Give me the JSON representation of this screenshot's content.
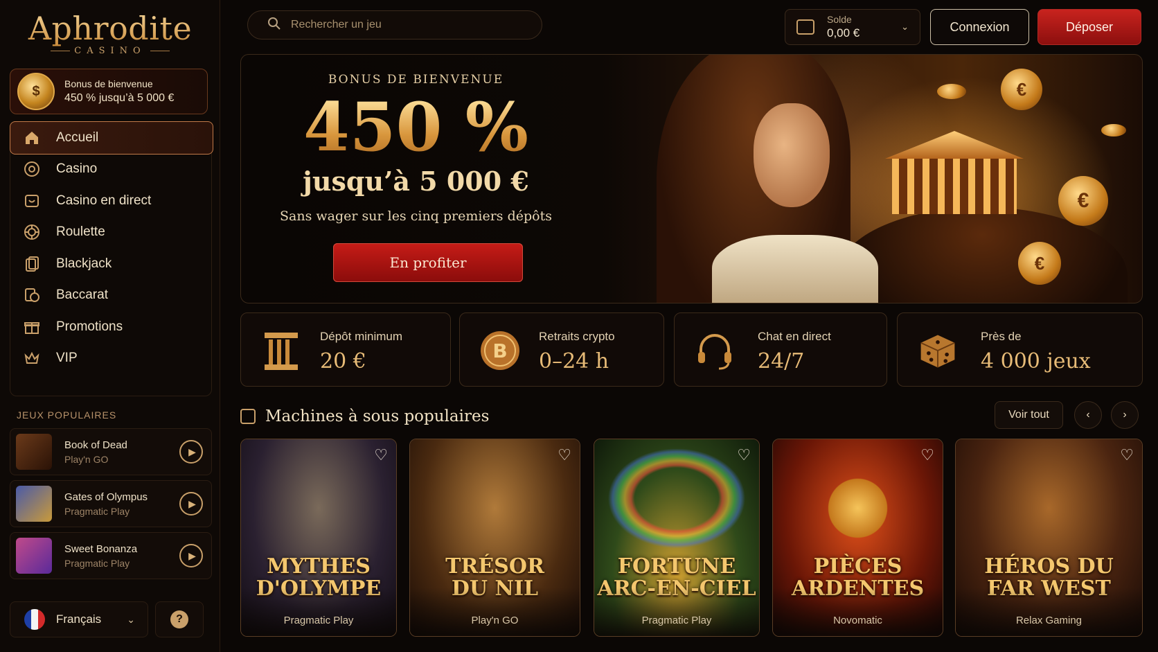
{
  "brand": {
    "name": "Aphrodite",
    "sub": "CASINO"
  },
  "sidebar": {
    "bonus": {
      "line1": "Bonus de bienvenue",
      "line2": "450 % jusqu’à 5 000 €"
    },
    "nav": [
      {
        "label": "Accueil",
        "icon": "home-icon",
        "active": true
      },
      {
        "label": "Casino",
        "icon": "chip-icon"
      },
      {
        "label": "Casino en direct",
        "icon": "live-casino-icon"
      },
      {
        "label": "Roulette",
        "icon": "roulette-icon"
      },
      {
        "label": "Blackjack",
        "icon": "cards-icon"
      },
      {
        "label": "Baccarat",
        "icon": "baccarat-icon"
      },
      {
        "label": "Promotions",
        "icon": "gift-icon"
      },
      {
        "label": "VIP",
        "icon": "crown-icon"
      }
    ],
    "popular_title": "JEUX POPULAIRES",
    "popular": [
      {
        "name": "Book of Dead",
        "provider": "Play'n GO"
      },
      {
        "name": "Gates of Olympus",
        "provider": "Pragmatic Play"
      },
      {
        "name": "Sweet Bonanza",
        "provider": "Pragmatic Play"
      }
    ],
    "language": "Français",
    "help": "?"
  },
  "header": {
    "search_placeholder": "Rechercher un jeu",
    "balance_label": "Solde",
    "balance_value": "0,00 €",
    "login": "Connexion",
    "deposit": "Déposer"
  },
  "hero": {
    "kicker": "BONUS DE BIENVENUE",
    "big": "450 %",
    "mid": "jusqu’à 5 000 €",
    "small": "Sans wager sur les cinq premiers dépôts",
    "cta": "En profiter"
  },
  "stats": [
    {
      "label": "Dépôt minimum",
      "value": "20 €",
      "icon": "column-icon"
    },
    {
      "label": "Retraits crypto",
      "value": "0–24 h",
      "icon": "bitcoin-icon"
    },
    {
      "label": "Chat en direct",
      "value": "24/7",
      "icon": "headset-icon"
    },
    {
      "label": "Près de",
      "value": "4 000 jeux",
      "icon": "dice-icon"
    }
  ],
  "slots": {
    "title": "Machines à sous populaires",
    "see_all": "Voir tout",
    "prev": "‹",
    "next": "›",
    "games": [
      {
        "title": "MYTHES\nD'OLYMPE",
        "provider": "Pragmatic Play"
      },
      {
        "title": "TRÉSOR\nDU NIL",
        "provider": "Play'n GO"
      },
      {
        "title": "FORTUNE\nARC-EN-CIEL",
        "provider": "Pragmatic Play"
      },
      {
        "title": "PIÈCES\nARDENTES",
        "provider": "Novomatic"
      },
      {
        "title": "HÉROS DU\nFAR WEST",
        "provider": "Relax Gaming"
      }
    ]
  },
  "colors": {
    "accent_gold": "#e3b36a",
    "cta_red": "#c8231e",
    "background": "#0b0705"
  }
}
